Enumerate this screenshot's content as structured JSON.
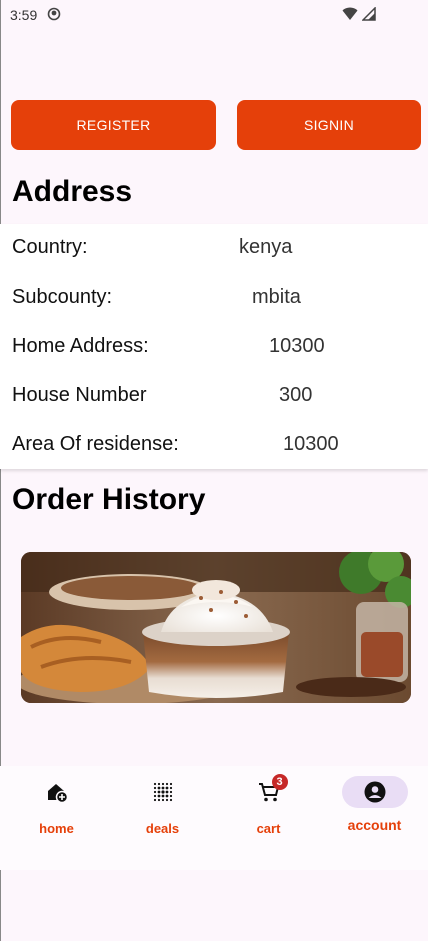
{
  "status_bar": {
    "time": "3:59"
  },
  "buttons": {
    "register": "REGISTER",
    "signin": "SIGNIN"
  },
  "address": {
    "title": "Address",
    "rows": [
      {
        "label": "Country:",
        "value": "kenya"
      },
      {
        "label": "Subcounty:",
        "value": "mbita"
      },
      {
        "label": "Home Address:",
        "value": "10300"
      },
      {
        "label": "House Number",
        "value": "300"
      },
      {
        "label": "Area Of residense:",
        "value": "10300"
      }
    ]
  },
  "orders": {
    "title": "Order History"
  },
  "nav": {
    "items": [
      {
        "label": "home",
        "icon": "home-add-icon"
      },
      {
        "label": "deals",
        "icon": "dots-grid-icon"
      },
      {
        "label": "cart",
        "icon": "cart-icon",
        "badge": "3"
      },
      {
        "label": "account",
        "icon": "account-icon",
        "active": true
      }
    ]
  },
  "colors": {
    "accent": "#e5400a",
    "background": "#fdf6fc",
    "active_pill": "#e9ddf5",
    "badge": "#c62828"
  }
}
